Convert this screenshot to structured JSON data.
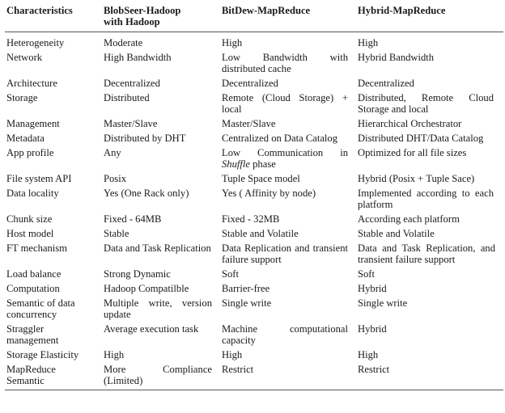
{
  "table": {
    "headers": [
      "Characteristics",
      "BlobSeer-Hadoop with Hadoop",
      "BitDew-MapReduce",
      "Hybrid-MapReduce"
    ],
    "rows": [
      {
        "characteristic": "Heterogeneity",
        "blobseer": "Moderate",
        "bitdew": "High",
        "hybrid": "High"
      },
      {
        "characteristic": "Network",
        "blobseer": "High Bandwidth",
        "bitdew": "Low Bandwidth with distributed cache",
        "hybrid": "Hybrid Bandwidth"
      },
      {
        "characteristic": "Architecture",
        "blobseer": "Decentralized",
        "bitdew": "Decentralized",
        "hybrid": "Decentralized"
      },
      {
        "characteristic": "Storage",
        "blobseer": "Distributed",
        "bitdew": "Remote (Cloud Storage) + local",
        "hybrid": "Distributed, Remote Cloud Storage and local"
      },
      {
        "characteristic": "Management",
        "blobseer": "Master/Slave",
        "bitdew": "Master/Slave",
        "hybrid": "Hierarchical Orchestrator"
      },
      {
        "characteristic": "Metadata",
        "blobseer": "Distributed by DHT",
        "bitdew": "Centralized on Data Catalog",
        "hybrid": "Distributed DHT/Data Catalog"
      },
      {
        "characteristic": "App profile",
        "blobseer": "Any",
        "bitdew_pre": "Low Communication in ",
        "bitdew_em": "Shuffle",
        "bitdew_post": " phase",
        "hybrid": "Optimized for all file sizes"
      },
      {
        "characteristic": "File system API",
        "blobseer": "Posix",
        "bitdew": "Tuple Space model",
        "hybrid": "Hybrid (Posix + Tuple Sace)"
      },
      {
        "characteristic": "Data locality",
        "blobseer": "Yes (One Rack only)",
        "bitdew": "Yes ( Affinity by node)",
        "hybrid": "Implemented according to each platform"
      },
      {
        "characteristic": "Chunk size",
        "blobseer": "Fixed - 64MB",
        "bitdew": "Fixed - 32MB",
        "hybrid": "According each platform"
      },
      {
        "characteristic": "Host model",
        "blobseer": "Stable",
        "bitdew": "Stable and Volatile",
        "hybrid": "Stable and Volatile"
      },
      {
        "characteristic": "FT mechanism",
        "blobseer": "Data and Task Replication",
        "bitdew": "Data Replication and transient failure support",
        "hybrid": "Data and Task Replication, and transient failure support"
      },
      {
        "characteristic": "Load balance",
        "blobseer": "Strong Dynamic",
        "bitdew": "Soft",
        "hybrid": "Soft"
      },
      {
        "characteristic": "Computation",
        "blobseer": "Hadoop Compatilble",
        "bitdew": "Barrier-free",
        "hybrid": "Hybrid"
      },
      {
        "characteristic": "Semantic of data concurrency",
        "blobseer": "Multiple write, version update",
        "bitdew": "Single write",
        "hybrid": "Single write"
      },
      {
        "characteristic": "Straggler management",
        "blobseer": "Average execution task",
        "bitdew": "Machine computational capacity",
        "hybrid": "Hybrid"
      },
      {
        "characteristic": "Storage Elasticity",
        "blobseer": "High",
        "bitdew": "High",
        "hybrid": "High"
      },
      {
        "characteristic": "MapReduce Semantic",
        "blobseer": "More Compliance (Limited)",
        "bitdew": "Restrict",
        "hybrid": "Restrict"
      }
    ]
  }
}
